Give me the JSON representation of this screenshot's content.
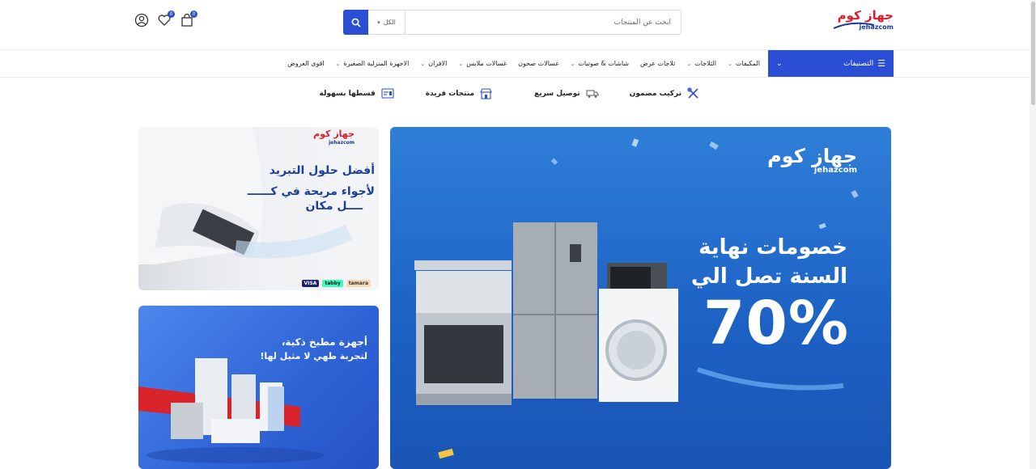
{
  "header": {
    "logo": {
      "arabic": "جهاز كوم",
      "latin": "jehazcom"
    },
    "search": {
      "placeholder": "ابحث عن المنتجات",
      "category": "الكل"
    },
    "cart_count": "0",
    "wishlist_count": "0"
  },
  "nav": {
    "categories_label": "التصنيفات",
    "items": [
      {
        "label": "المكيفات",
        "dropdown": true
      },
      {
        "label": "الثلاجات",
        "dropdown": true
      },
      {
        "label": "ثلاجات عرض",
        "dropdown": false
      },
      {
        "label": "شاشات & صوتيات",
        "dropdown": true
      },
      {
        "label": "غسالات صحون",
        "dropdown": false
      },
      {
        "label": "غسالات ملابس",
        "dropdown": true
      },
      {
        "label": "الافران",
        "dropdown": true
      },
      {
        "label": "الاجهزة المنزلية الصغيرة",
        "dropdown": true
      },
      {
        "label": "اقوى العروض",
        "dropdown": false
      }
    ]
  },
  "features": [
    {
      "label": "تركيب مضمون",
      "icon": "tools-icon"
    },
    {
      "label": "توصيل سريع",
      "icon": "truck-icon"
    },
    {
      "label": "منتجات فريدة",
      "icon": "store-icon"
    },
    {
      "label": "قسطها بسهولة",
      "icon": "installment-icon"
    }
  ],
  "banners": {
    "main": {
      "logo_ar": "جهاز كوم",
      "logo_en": "jehazcom",
      "line1": "خصومات نهاية",
      "line2": "السنة تصل الي",
      "discount": "70%"
    },
    "ac": {
      "logo_ar": "جهاز كوم",
      "logo_en": "jehazcom",
      "line1": "أفضل حلول التبريد",
      "line2": "لأجواء مريحة في كــــــ",
      "line3": "ــــل مكان",
      "payments": [
        "tamara",
        "tabby",
        "VISA"
      ]
    },
    "kitchen": {
      "line1": "أجهزة مطبخ ذكية،",
      "line2": "لتجربة طهي لا مثيل لها!"
    }
  },
  "colors": {
    "brand_blue": "#2b4fd4",
    "brand_red": "#e21b2c",
    "banner_blue": "#1c60c4"
  }
}
